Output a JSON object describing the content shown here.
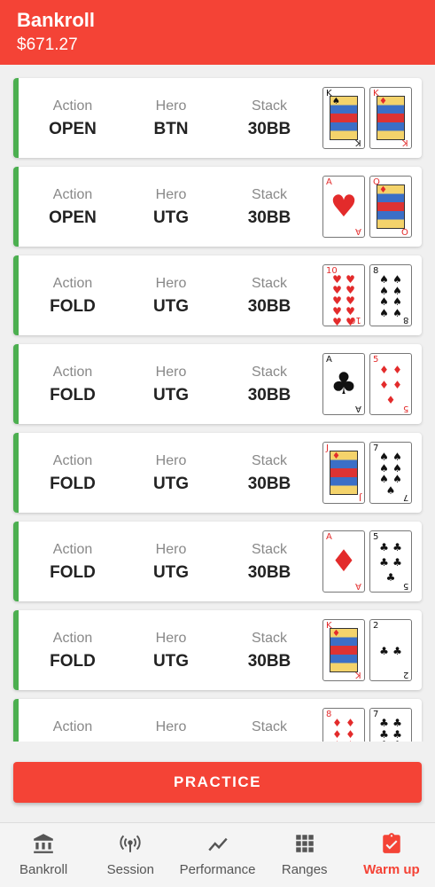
{
  "header": {
    "title": "Bankroll",
    "amount": "$671.27"
  },
  "colors": {
    "primary": "#f44336",
    "row_border": "#4caf50"
  },
  "labels": {
    "action": "Action",
    "hero": "Hero",
    "stack": "Stack"
  },
  "hands": [
    {
      "action": "OPEN",
      "hero": "BTN",
      "stack": "30BB",
      "cards": [
        {
          "rank": "K",
          "suit": "♠",
          "color": "black"
        },
        {
          "rank": "K",
          "suit": "♦",
          "color": "red"
        }
      ]
    },
    {
      "action": "OPEN",
      "hero": "UTG",
      "stack": "30BB",
      "cards": [
        {
          "rank": "A",
          "suit": "♥",
          "color": "red"
        },
        {
          "rank": "Q",
          "suit": "♦",
          "color": "red"
        }
      ]
    },
    {
      "action": "FOLD",
      "hero": "UTG",
      "stack": "30BB",
      "cards": [
        {
          "rank": "10",
          "suit": "♥",
          "color": "red"
        },
        {
          "rank": "8",
          "suit": "♠",
          "color": "black"
        }
      ]
    },
    {
      "action": "FOLD",
      "hero": "UTG",
      "stack": "30BB",
      "cards": [
        {
          "rank": "A",
          "suit": "♣",
          "color": "black"
        },
        {
          "rank": "5",
          "suit": "♦",
          "color": "red"
        }
      ]
    },
    {
      "action": "FOLD",
      "hero": "UTG",
      "stack": "30BB",
      "cards": [
        {
          "rank": "J",
          "suit": "♦",
          "color": "red"
        },
        {
          "rank": "7",
          "suit": "♠",
          "color": "black"
        }
      ]
    },
    {
      "action": "FOLD",
      "hero": "UTG",
      "stack": "30BB",
      "cards": [
        {
          "rank": "A",
          "suit": "♦",
          "color": "red"
        },
        {
          "rank": "5",
          "suit": "♣",
          "color": "black"
        }
      ]
    },
    {
      "action": "FOLD",
      "hero": "UTG",
      "stack": "30BB",
      "cards": [
        {
          "rank": "K",
          "suit": "♦",
          "color": "red"
        },
        {
          "rank": "2",
          "suit": "♣",
          "color": "black"
        }
      ]
    },
    {
      "action": "",
      "hero": "",
      "stack": "",
      "cards": [
        {
          "rank": "8",
          "suit": "♦",
          "color": "red"
        },
        {
          "rank": "7",
          "suit": "♣",
          "color": "black"
        }
      ]
    }
  ],
  "practice_label": "PRACTICE",
  "nav": [
    {
      "label": "Bankroll",
      "icon": "bank-icon",
      "active": false
    },
    {
      "label": "Session",
      "icon": "broadcast-icon",
      "active": false
    },
    {
      "label": "Performance",
      "icon": "trend-icon",
      "active": false
    },
    {
      "label": "Ranges",
      "icon": "grid-icon",
      "active": false
    },
    {
      "label": "Warm up",
      "icon": "clipboard-check-icon",
      "active": true
    }
  ]
}
